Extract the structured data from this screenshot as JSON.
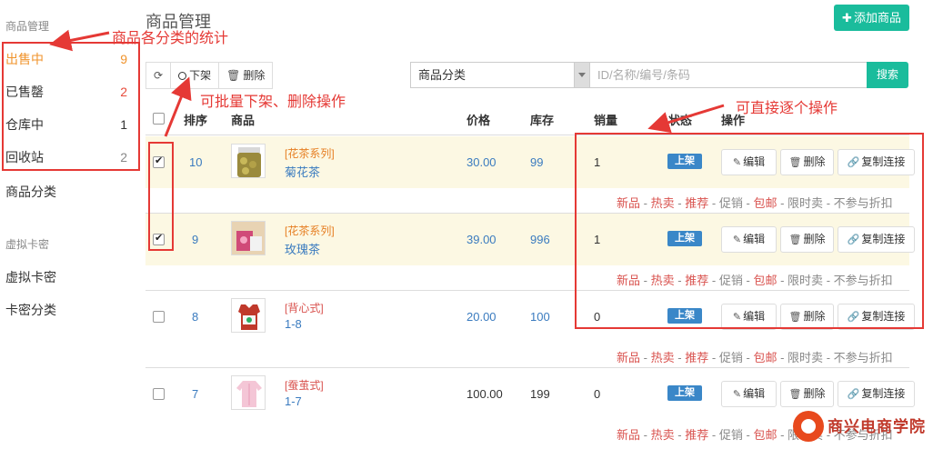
{
  "sidebar": {
    "heading1": "商品管理",
    "items": [
      {
        "label": "出售中",
        "count": "9"
      },
      {
        "label": "已售罄",
        "count": "2"
      },
      {
        "label": "仓库中",
        "count": "1"
      },
      {
        "label": "回收站",
        "count": "2"
      }
    ],
    "category": "商品分类",
    "heading2": "虚拟卡密",
    "links": [
      "虚拟卡密",
      "卡密分类"
    ]
  },
  "header": {
    "title": "商品管理",
    "add_label": "添加商品"
  },
  "toolbar": {
    "refresh_icon": "refresh-icon",
    "offshelf_label": "下架",
    "delete_label": "删除"
  },
  "search": {
    "category_value": "商品分类",
    "placeholder": "ID/名称/编号/条码",
    "button": "搜索"
  },
  "table": {
    "columns": {
      "sort": "排序",
      "product": "商品",
      "price": "价格",
      "stock": "库存",
      "sales": "销量",
      "status": "状态",
      "actions": "操作"
    },
    "rows": [
      {
        "checked": true,
        "sort": "10",
        "category": "[花茶系列]",
        "name": "菊花茶",
        "price": "30.00",
        "stock": "99",
        "sales": "1",
        "status": "上架"
      },
      {
        "checked": true,
        "sort": "9",
        "category": "[花茶系列]",
        "name": "玫瑰茶",
        "price": "39.00",
        "stock": "996",
        "sales": "1",
        "status": "上架"
      },
      {
        "checked": false,
        "sort": "8",
        "category": "[背心式]",
        "name": "1-8",
        "price": "20.00",
        "stock": "100",
        "sales": "0",
        "status": "上架"
      },
      {
        "checked": false,
        "sort": "7",
        "category": "[蚕茧式]",
        "name": "1-7",
        "price": "100.00",
        "stock": "199",
        "sales": "0",
        "status": "上架"
      }
    ],
    "actions": {
      "edit": "编辑",
      "delete": "删除",
      "copy": "复制连接"
    },
    "tags": {
      "new": "新品",
      "hot": "热卖",
      "recommend": "推荐",
      "promo": "促销",
      "freeship": "包邮",
      "limited": "限时卖",
      "nodiscount": "不参与折扣",
      "sep": "-"
    }
  },
  "annotations": {
    "category_stats": "商品各分类的统计",
    "batch_ops": "可批量下架、删除操作",
    "direct_ops": "可直接逐个操作"
  },
  "watermark": {
    "text": "商兴电商学院"
  },
  "colors": {
    "accent": "#1abc9c",
    "annotation": "#e53935",
    "active": "#f0932b",
    "badge": "#3a87c8"
  }
}
